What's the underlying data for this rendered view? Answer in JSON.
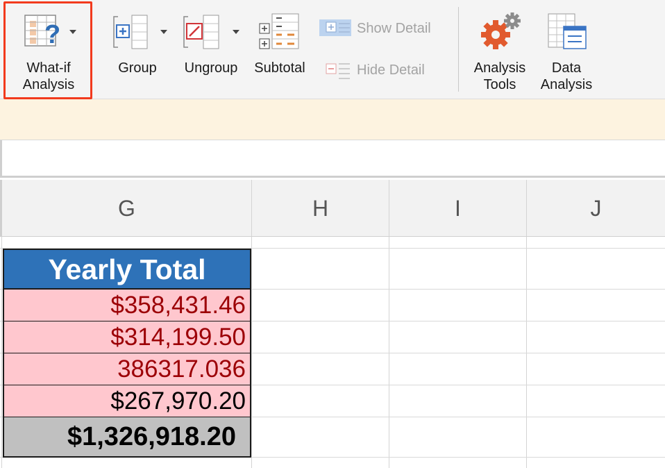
{
  "ribbon": {
    "what_if": "What-if\nAnalysis",
    "group": "Group",
    "ungroup": "Ungroup",
    "subtotal": "Subtotal",
    "show_detail": "Show Detail",
    "hide_detail": "Hide Detail",
    "analysis_tools": "Analysis\nTools",
    "data_analysis": "Data\nAnalysis"
  },
  "columns": [
    "G",
    "H",
    "I",
    "J"
  ],
  "table": {
    "header": "Yearly Total",
    "rows": [
      "$358,431.46",
      "$314,199.50",
      "386317.036",
      "$267,970.20"
    ],
    "total": "$1,326,918.20"
  },
  "colors": {
    "highlight": "#f23a1d",
    "header_bg": "#2e72b8",
    "value_bg": "#ffc7ce",
    "value_text": "#9c0006",
    "total_bg": "#c0c0c0"
  }
}
